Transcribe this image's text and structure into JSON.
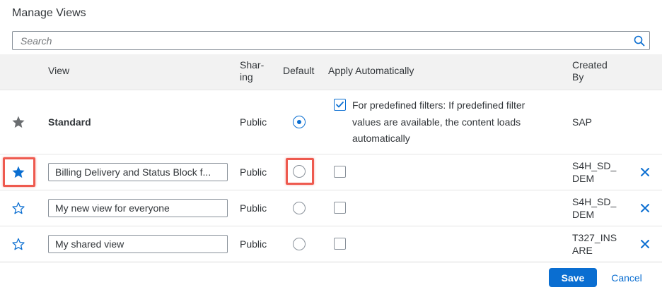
{
  "dialog": {
    "title": "Manage Views",
    "search": {
      "placeholder": "Search",
      "value": ""
    },
    "columns": {
      "view": "View",
      "sharing": "Shar-\ning",
      "default": "Default",
      "apply_automatically": "Apply Automatically",
      "created_by": "Created\nBy"
    },
    "rows": [
      {
        "favorite": true,
        "favorite_style": "filled-gray",
        "name": "Standard",
        "sharing": "Public",
        "is_default": true,
        "apply_auto": true,
        "apply_auto_text": "For predefined filters: If predefined filter values are available, the content loads automatically",
        "created_by": "SAP"
      },
      {
        "favorite": true,
        "favorite_style": "filled-blue",
        "name": "Billing Delivery and Status Block f...",
        "sharing": "Public",
        "is_default": false,
        "apply_auto": false,
        "created_by": "S4H_SD_\nDEM",
        "deletable": true
      },
      {
        "favorite": false,
        "favorite_style": "outline-blue",
        "name": "My new view for everyone",
        "sharing": "Public",
        "is_default": false,
        "apply_auto": false,
        "created_by": "S4H_SD_\nDEM",
        "deletable": true
      },
      {
        "favorite": false,
        "favorite_style": "outline-blue",
        "name": "My shared view",
        "sharing": "Public",
        "is_default": false,
        "apply_auto": false,
        "created_by": "T327_INS\nARE",
        "deletable": true
      }
    ],
    "buttons": {
      "save": "Save",
      "cancel": "Cancel"
    }
  },
  "icons": {
    "search": "search-icon",
    "star_filled": "star-filled-icon",
    "star_outline": "star-outline-icon",
    "checkmark": "checkmark-icon",
    "delete": "decline-icon"
  },
  "colors": {
    "accent": "#0a6ed1",
    "highlight": "#ee5a4f",
    "star_gray": "#6a6d70"
  }
}
